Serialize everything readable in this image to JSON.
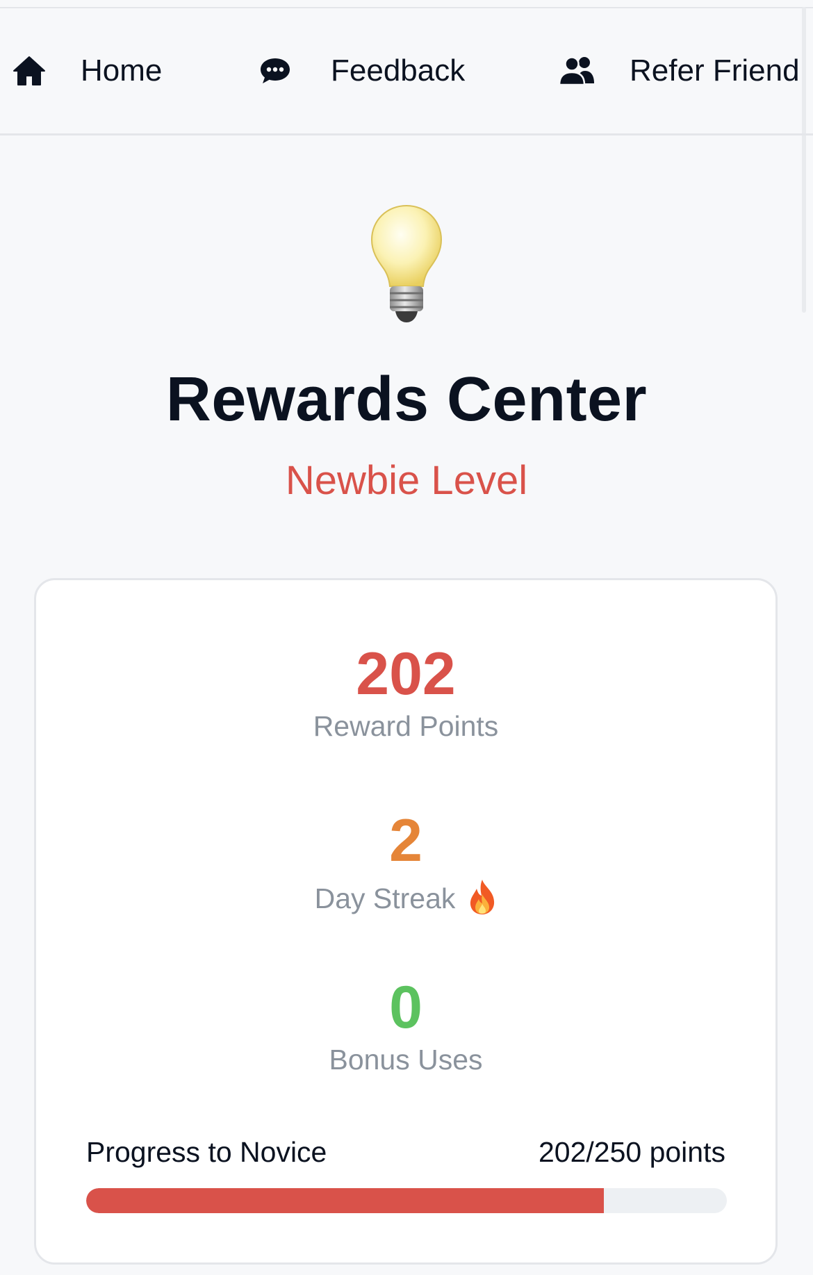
{
  "nav": {
    "items": [
      {
        "label": "Home",
        "icon": "home-icon"
      },
      {
        "label": "Feedback",
        "icon": "chat-bubble-icon"
      },
      {
        "label": "Refer Friend",
        "icon": "users-icon"
      }
    ]
  },
  "hero": {
    "icon": "light-bulb-icon",
    "title": "Rewards Center",
    "level": "Newbie Level"
  },
  "stats": {
    "points": {
      "value": "202",
      "label": "Reward Points",
      "color": "#d9524a"
    },
    "streak": {
      "value": "2",
      "label": "Day Streak",
      "icon": "fire-icon",
      "color": "#e58538"
    },
    "bonus": {
      "value": "0",
      "label": "Bonus Uses",
      "color": "#5cc25f"
    }
  },
  "progress": {
    "label": "Progress to Novice",
    "value_text": "202/250 points",
    "current": 202,
    "target": 250,
    "color": "#d9524a"
  }
}
